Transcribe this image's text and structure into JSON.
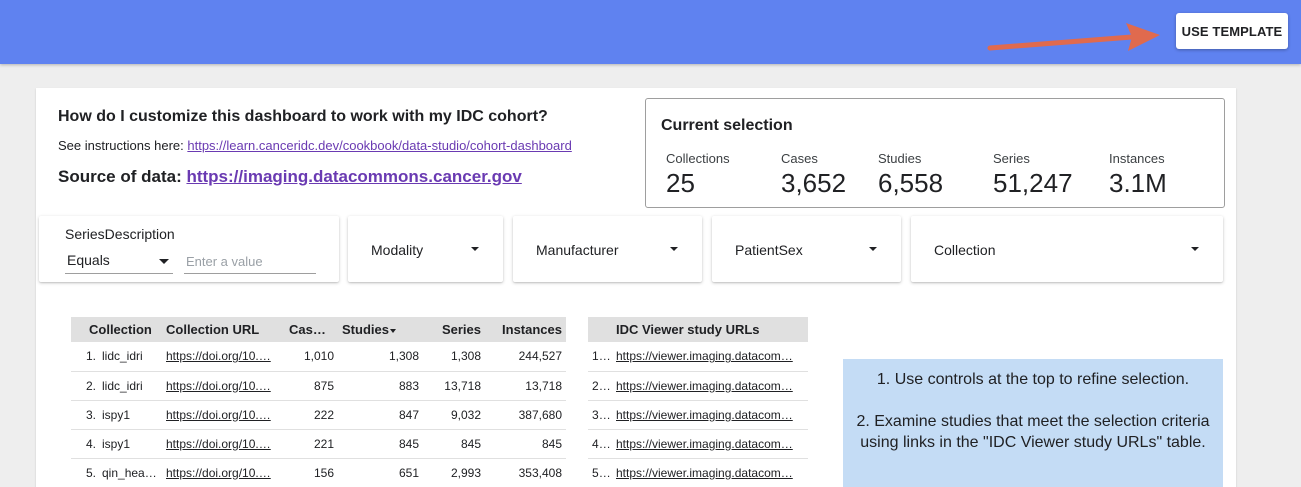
{
  "header": {
    "use_template_label": "USE TEMPLATE"
  },
  "intro": {
    "question": "How do I customize this dashboard to work with my IDC cohort?",
    "instructions_prefix": "See instructions here: ",
    "instructions_link": "https://learn.canceridc.dev/cookbook/data-studio/cohort-dashboard",
    "source_prefix": "Source of data: ",
    "source_link": "https://imaging.datacommons.cancer.gov"
  },
  "selection": {
    "title": "Current selection",
    "metrics": [
      {
        "label": "Collections",
        "value": "25"
      },
      {
        "label": "Cases",
        "value": "3,652"
      },
      {
        "label": "Studies",
        "value": "6,558"
      },
      {
        "label": "Series",
        "value": "51,247"
      },
      {
        "label": "Instances",
        "value": "3.1M"
      }
    ]
  },
  "filters": {
    "series_description": {
      "label": "SeriesDescription",
      "operator": "Equals",
      "placeholder": "Enter a value"
    },
    "dropdowns": [
      {
        "label": "Modality"
      },
      {
        "label": "Manufacturer"
      },
      {
        "label": "PatientSex"
      },
      {
        "label": "Collection"
      }
    ]
  },
  "collections_table": {
    "headers": [
      "Collection",
      "Collection URL",
      "Cas…",
      "Studies",
      "Series",
      "Instances"
    ],
    "rows": [
      {
        "idx": "1.",
        "collection": "lidc_idri",
        "url": "https://doi.org/10.…",
        "cases": "1,010",
        "studies": "1,308",
        "series": "1,308",
        "instances": "244,527"
      },
      {
        "idx": "2.",
        "collection": "lidc_idri",
        "url": "https://doi.org/10.…",
        "cases": "875",
        "studies": "883",
        "series": "13,718",
        "instances": "13,718"
      },
      {
        "idx": "3.",
        "collection": "ispy1",
        "url": "https://doi.org/10.…",
        "cases": "222",
        "studies": "847",
        "series": "9,032",
        "instances": "387,680"
      },
      {
        "idx": "4.",
        "collection": "ispy1",
        "url": "https://doi.org/10.…",
        "cases": "221",
        "studies": "845",
        "series": "845",
        "instances": "845"
      },
      {
        "idx": "5.",
        "collection": "qin_headn…",
        "url": "https://doi.org/10.…",
        "cases": "156",
        "studies": "651",
        "series": "2,993",
        "instances": "353,408"
      }
    ]
  },
  "viewer_table": {
    "header": "IDC Viewer study URLs",
    "rows": [
      {
        "idx": "1…",
        "url": "https://viewer.imaging.datacom…"
      },
      {
        "idx": "2…",
        "url": "https://viewer.imaging.datacom…"
      },
      {
        "idx": "3…",
        "url": "https://viewer.imaging.datacom…"
      },
      {
        "idx": "4…",
        "url": "https://viewer.imaging.datacom…"
      },
      {
        "idx": "5…",
        "url": "https://viewer.imaging.datacom…"
      }
    ]
  },
  "help": {
    "line1": "1. Use controls at the top to refine selection.",
    "line2": "2. Examine studies that meet the selection criteria using links in the \"IDC Viewer study URLs\" table."
  },
  "colors": {
    "topbar": "#5f82f0",
    "arrow": "#e06a4e",
    "link": "#6a3ab2",
    "help_bg": "#c4dcf5"
  }
}
